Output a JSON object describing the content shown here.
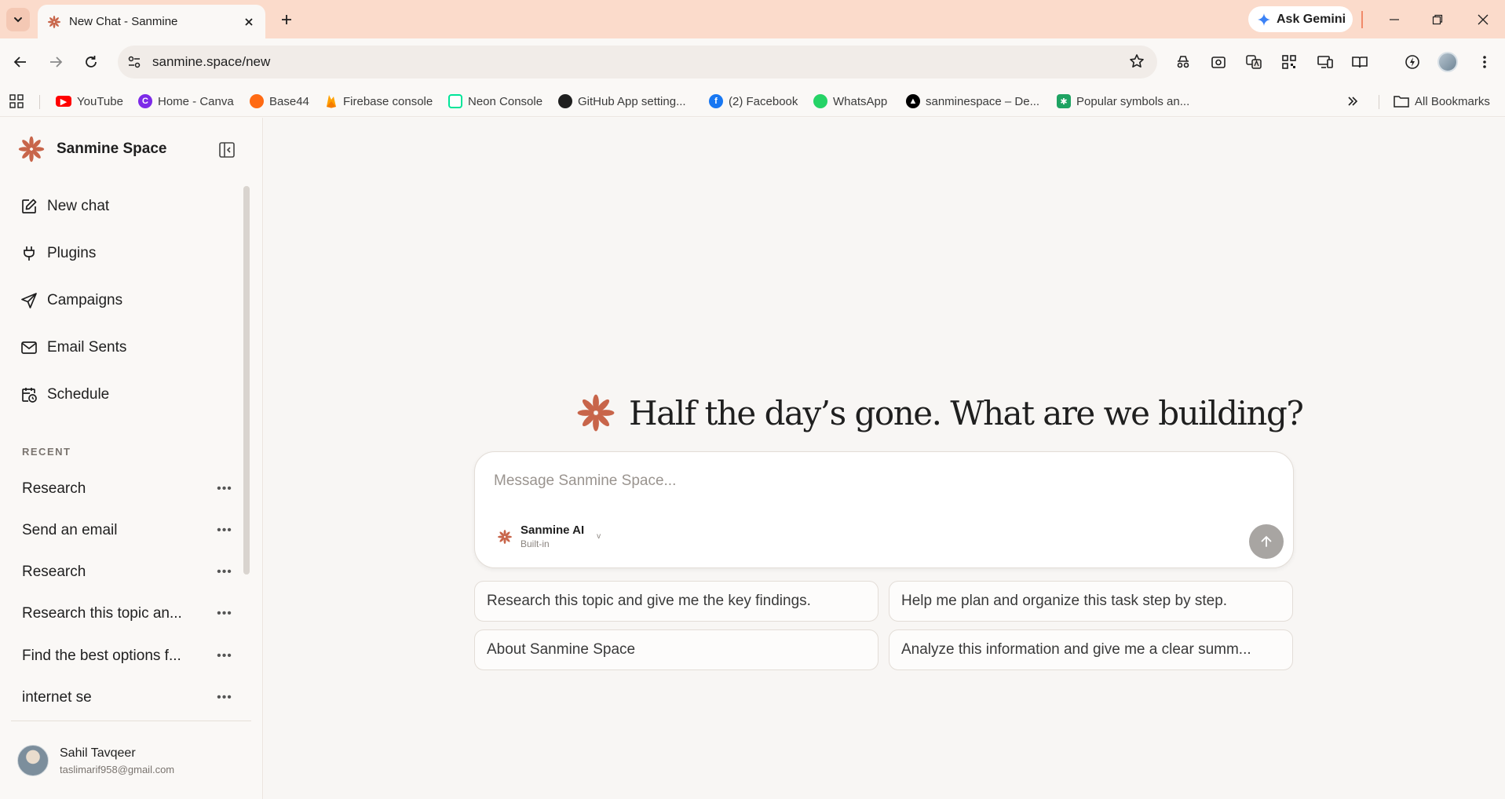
{
  "browser": {
    "tab_title": "New Chat - Sanmine",
    "url": "sanmine.space/new",
    "ask_gemini": "Ask Gemini",
    "bookmarks": [
      {
        "label": "YouTube",
        "icon": "youtube-icon",
        "color": "#ff0000"
      },
      {
        "label": "Home - Canva",
        "icon": "canva-icon",
        "color": "#7d2ae8"
      },
      {
        "label": "Base44",
        "icon": "base44-icon",
        "color": "#ff6a13"
      },
      {
        "label": "Firebase console",
        "icon": "firebase-icon",
        "color": "#ffa000"
      },
      {
        "label": "Neon Console",
        "icon": "neon-icon",
        "color": "#00e599"
      },
      {
        "label": "GitHub App setting...",
        "icon": "github-icon",
        "color": "#1f1f1f"
      },
      {
        "label": "(2) Facebook",
        "icon": "facebook-icon",
        "color": "#1877f2"
      },
      {
        "label": "WhatsApp",
        "icon": "whatsapp-icon",
        "color": "#25d366"
      },
      {
        "label": "sanminespace – De...",
        "icon": "vercel-icon",
        "color": "#000000"
      },
      {
        "label": "Popular symbols an...",
        "icon": "symbols-icon",
        "color": "#1ea362"
      }
    ],
    "all_bookmarks": "All Bookmarks"
  },
  "sidebar": {
    "brand": "Sanmine Space",
    "nav": [
      {
        "label": "New chat",
        "icon": "edit-icon"
      },
      {
        "label": "Plugins",
        "icon": "plug-icon"
      },
      {
        "label": "Campaigns",
        "icon": "send-icon"
      },
      {
        "label": "Email Sents",
        "icon": "mail-icon"
      },
      {
        "label": "Schedule",
        "icon": "calendar-clock-icon"
      }
    ],
    "recent_label": "RECENT",
    "recent": [
      {
        "label": "Research"
      },
      {
        "label": "Send an email"
      },
      {
        "label": "Research"
      },
      {
        "label": "Research this topic an..."
      },
      {
        "label": "Find the best options f..."
      },
      {
        "label": "internet se"
      }
    ],
    "more_glyph": "•••",
    "user": {
      "name": "Sahil Tavqeer",
      "email": "taslimarif958@gmail.com"
    }
  },
  "main": {
    "greeting": "Half the day’s gone. What are we building?",
    "composer": {
      "placeholder": "Message Sanmine Space...",
      "model_name": "Sanmine AI",
      "model_sub": "Built-in",
      "model_chevron": "v"
    },
    "suggestions": [
      {
        "label": "Research this topic and give me the key findings."
      },
      {
        "label": "Help me plan and organize this task step by step."
      },
      {
        "label": "About Sanmine Space"
      },
      {
        "label": "Analyze this information and give me a clear summ..."
      }
    ]
  },
  "colors": {
    "accent": "#c8654a",
    "tabbar": "#fbdbcb",
    "send_disabled": "#a8a5a2"
  }
}
